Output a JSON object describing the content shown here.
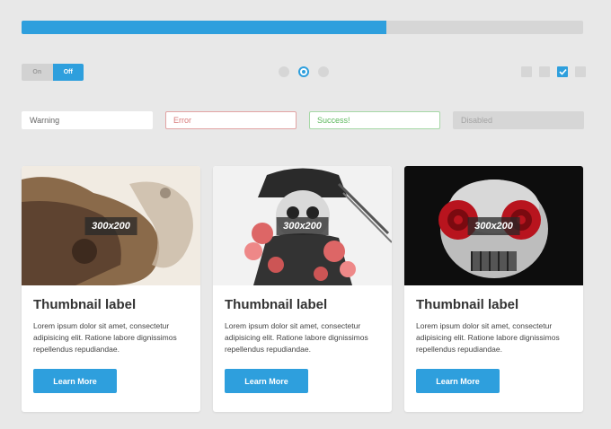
{
  "progress": {
    "value": 0.65,
    "color": "#2e9fdd"
  },
  "toggle": {
    "on_label": "On",
    "off_label": "Off",
    "active": "Off"
  },
  "radios": {
    "count": 3,
    "selected_index": 1
  },
  "checkboxes": {
    "count": 4,
    "checked_index": 2
  },
  "inputs": {
    "warning": {
      "value": "Warning"
    },
    "error": {
      "value": "Error"
    },
    "success": {
      "value": "Success!"
    },
    "disabled": {
      "value": "Disabled"
    }
  },
  "cards": [
    {
      "image_label": "300x200",
      "title": "Thumbnail label",
      "text": "Lorem ipsum dolor sit amet, consectetur adipisicing elit. Ratione labore dignissimos repellendus repudiandae.",
      "button": "Learn More"
    },
    {
      "image_label": "300x200",
      "title": "Thumbnail label",
      "text": "Lorem ipsum dolor sit amet, consectetur adipisicing elit. Ratione labore dignissimos repellendus repudiandae.",
      "button": "Learn More"
    },
    {
      "image_label": "300x200",
      "title": "Thumbnail label",
      "text": "Lorem ipsum dolor sit amet, consectetur adipisicing elit. Ratione labore dignissimos repellendus repudiandae.",
      "button": "Learn More"
    }
  ],
  "colors": {
    "accent": "#2e9fdd",
    "error": "#d87a7a",
    "success": "#5cb85c"
  }
}
